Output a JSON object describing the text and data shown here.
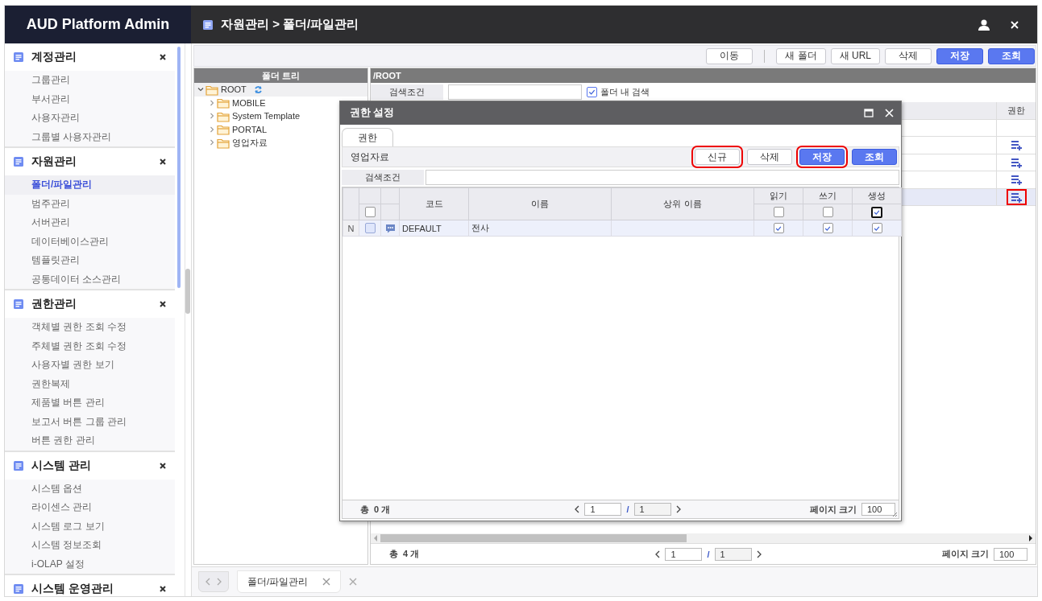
{
  "app": {
    "title": "AUD Platform Admin"
  },
  "header": {
    "breadcrumb": "자원관리 > 폴더/파일관리"
  },
  "sidebar": {
    "sections": [
      {
        "title": "계정관리",
        "items": [
          {
            "label": "그룹관리",
            "selected": false
          },
          {
            "label": "부서관리",
            "selected": false
          },
          {
            "label": "사용자관리",
            "selected": false
          },
          {
            "label": "그룹별 사용자관리",
            "selected": false
          }
        ]
      },
      {
        "title": "자원관리",
        "items": [
          {
            "label": "폴더/파일관리",
            "selected": true
          },
          {
            "label": "범주관리",
            "selected": false
          },
          {
            "label": "서버관리",
            "selected": false
          },
          {
            "label": "데이터베이스관리",
            "selected": false
          },
          {
            "label": "템플릿관리",
            "selected": false
          },
          {
            "label": "공통데이터 소스관리",
            "selected": false
          }
        ]
      },
      {
        "title": "권한관리",
        "items": [
          {
            "label": "객체별 권한 조회 수정",
            "selected": false
          },
          {
            "label": "주체별 권한 조회 수정",
            "selected": false
          },
          {
            "label": "사용자별 권한 보기",
            "selected": false
          },
          {
            "label": "권한복제",
            "selected": false
          },
          {
            "label": "제품별 버튼 관리",
            "selected": false
          },
          {
            "label": "보고서 버튼 그룹 관리",
            "selected": false
          },
          {
            "label": "버튼 권한 관리",
            "selected": false
          }
        ]
      },
      {
        "title": "시스템 관리",
        "items": [
          {
            "label": "시스템 옵션",
            "selected": false
          },
          {
            "label": "라이센스 관리",
            "selected": false
          },
          {
            "label": "시스템 로그 보기",
            "selected": false
          },
          {
            "label": "시스템 정보조회",
            "selected": false
          },
          {
            "label": "i-OLAP 설정",
            "selected": false
          }
        ]
      },
      {
        "title": "시스템 운영관리"
      }
    ]
  },
  "toolbar": {
    "items": [
      {
        "label": "이동",
        "kind": "default"
      },
      {
        "kind": "separator"
      },
      {
        "label": "새 폴더",
        "kind": "default"
      },
      {
        "label": "새 URL",
        "kind": "default"
      },
      {
        "label": "삭제",
        "kind": "default"
      },
      {
        "label": "저장",
        "kind": "primary"
      },
      {
        "label": "조회",
        "kind": "primary"
      }
    ]
  },
  "folder_tree": {
    "title": "폴더 트리",
    "nodes": [
      {
        "label": "ROOT",
        "expanded": true,
        "children": [
          {
            "label": "MOBILE",
            "expanded": false
          },
          {
            "label": "System Template",
            "expanded": false
          },
          {
            "label": "PORTAL",
            "expanded": false
          },
          {
            "label": "영업자료",
            "expanded": false
          }
        ]
      }
    ]
  },
  "content": {
    "path": "/ROOT",
    "search_label": "검색조건",
    "search_in_folder": {
      "label": "폴더 내 검색",
      "checked": true
    },
    "table": {
      "columns": [
        "권한"
      ],
      "rows": [
        {
          "selected": false,
          "highlighted": false
        },
        {
          "selected": false,
          "highlighted": false
        },
        {
          "selected": false,
          "highlighted": false
        },
        {
          "selected": true,
          "highlighted": true
        }
      ]
    },
    "footer": {
      "total": "총  4 개",
      "page": "1",
      "separator": "/",
      "pages": "1",
      "page_size_label": "페이지 크기",
      "page_size": "100"
    }
  },
  "bottom_tabs": [
    {
      "label": "폴더/파일관리",
      "selected": true
    }
  ],
  "dialog": {
    "title": "권한 설정",
    "tabs": [
      {
        "label": "권한",
        "selected": true
      }
    ],
    "folder": "영업자료",
    "buttons": [
      {
        "label": "신규",
        "kind": "default",
        "highlighted": true
      },
      {
        "label": "삭제",
        "kind": "default",
        "highlighted": false
      },
      {
        "label": "저장",
        "kind": "primary",
        "highlighted": true
      },
      {
        "label": "조회",
        "kind": "primary",
        "highlighted": false
      }
    ],
    "search_label": "검색조건",
    "grid": {
      "columns": [
        "코드",
        "이름",
        "상위 이름",
        "읽기",
        "쓰기",
        "생성"
      ],
      "header_checks": {
        "select_all": false,
        "read": false,
        "write": false,
        "create": true,
        "create_focused": true
      },
      "rows": [
        {
          "state": "N",
          "checked": false,
          "code": "DEFAULT",
          "name": "전사",
          "read": true,
          "write": true,
          "create": true
        }
      ]
    },
    "footer": {
      "total": "총  0 개",
      "page": "1",
      "separator": "/",
      "pages": "1",
      "page_size_label": "페이지 크기",
      "page_size": "100"
    }
  }
}
